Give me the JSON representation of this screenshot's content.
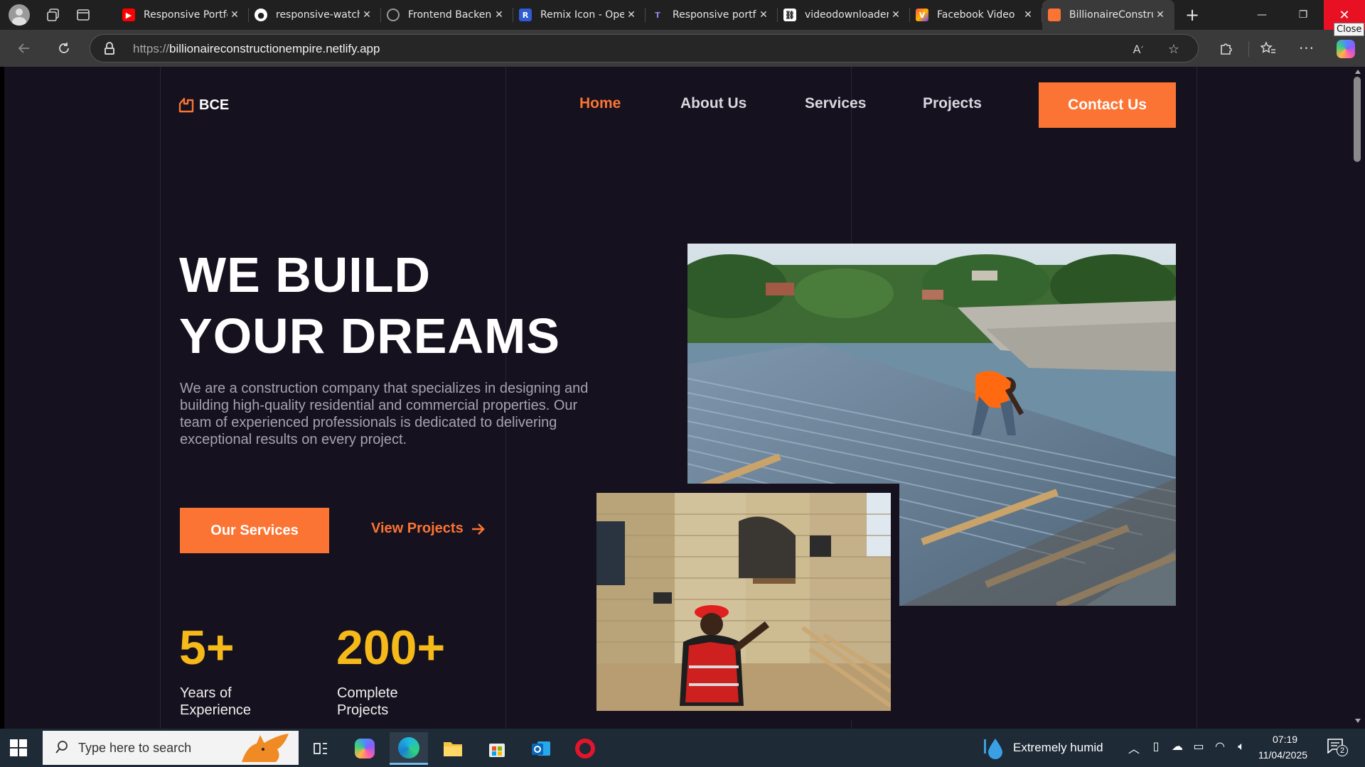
{
  "browser": {
    "tabs": [
      {
        "title": "Responsive Portfolio",
        "icon": "youtube-icon",
        "color": "#ff0000"
      },
      {
        "title": "responsive-watch",
        "icon": "github-icon",
        "color": "#ffffff"
      },
      {
        "title": "Frontend Backend",
        "icon": "globe-icon",
        "color": "#9a9a9a"
      },
      {
        "title": "Remix Icon - Open",
        "icon": "remix-icon",
        "color": "#2f5bd3"
      },
      {
        "title": "Responsive portfolio",
        "icon": "t-icon",
        "color": "#6a6ad0"
      },
      {
        "title": "videodownloader",
        "icon": "link-icon",
        "color": "#ffffff"
      },
      {
        "title": "Facebook Video",
        "icon": "vidio-icon",
        "color": "#ff7a00"
      },
      {
        "title": "BillionaireConstruction",
        "icon": "bce-icon",
        "color": "#fb7433"
      }
    ],
    "tooltip": "Close",
    "url_protocol": "https://",
    "url_host": "billionaireconstructionempire.netlify.app"
  },
  "site": {
    "logo": "BCE",
    "nav": [
      "Home",
      "About Us",
      "Services",
      "Projects"
    ],
    "contact_button": "Contact Us",
    "hero_line1": "WE BUILD",
    "hero_line2": "YOUR DREAMS",
    "hero_desc": "We are a construction company that specializes in designing and building high-quality residential and commercial properties. Our team of experienced professionals is dedicated to delivering exceptional results on every project.",
    "primary_button": "Our Services",
    "secondary_link": "View Projects",
    "stats": [
      {
        "value": "5+",
        "label_line1": "Years of",
        "label_line2": "Experience"
      },
      {
        "value": "200+",
        "label_line1": "Complete",
        "label_line2": "Projects"
      }
    ],
    "accent_color": "#fb7433",
    "stat_color": "#f6b91a",
    "background_color": "#15111e"
  },
  "taskbar": {
    "search_placeholder": "Type here to search",
    "weather": "Extremely humid",
    "time": "07:19",
    "date": "11/04/2025",
    "notifications": "2"
  }
}
